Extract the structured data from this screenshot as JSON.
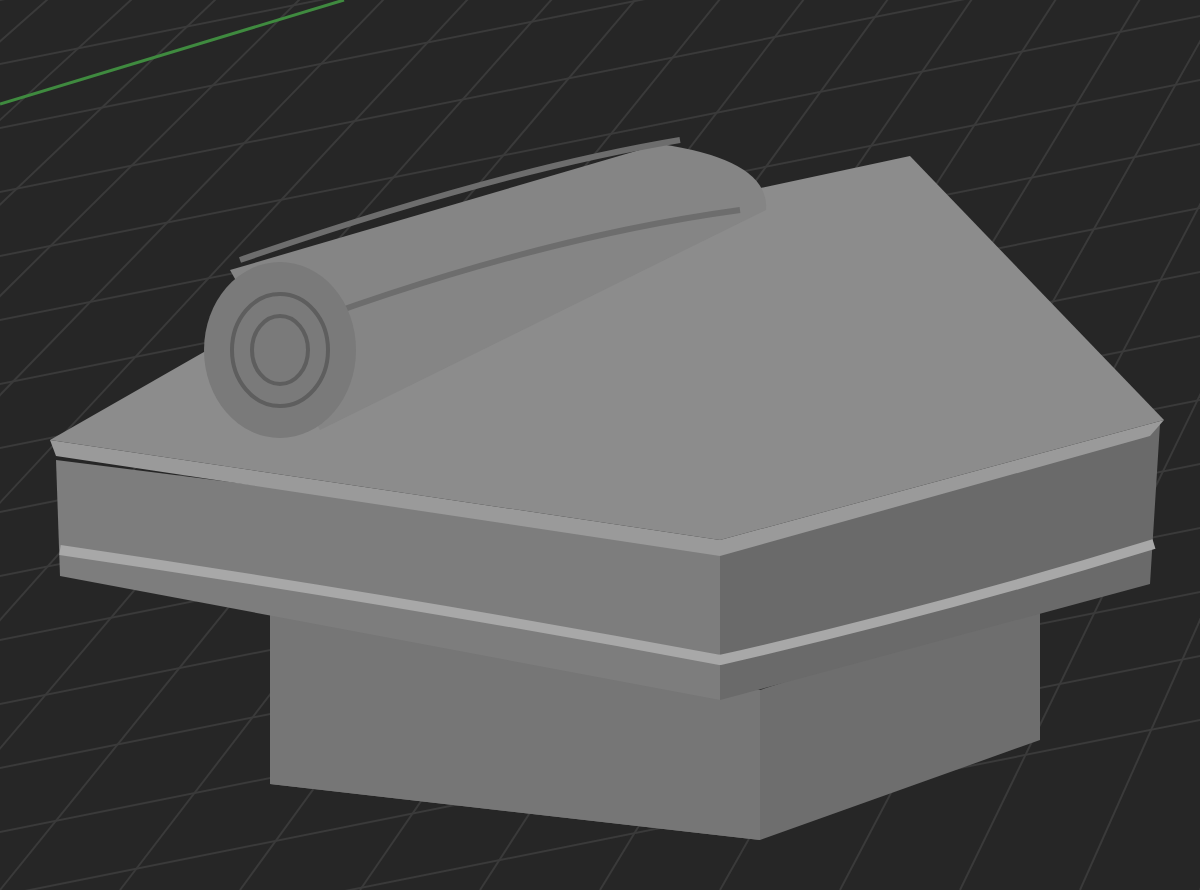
{
  "viewport": {
    "show_grid": true,
    "show_axis": true
  }
}
